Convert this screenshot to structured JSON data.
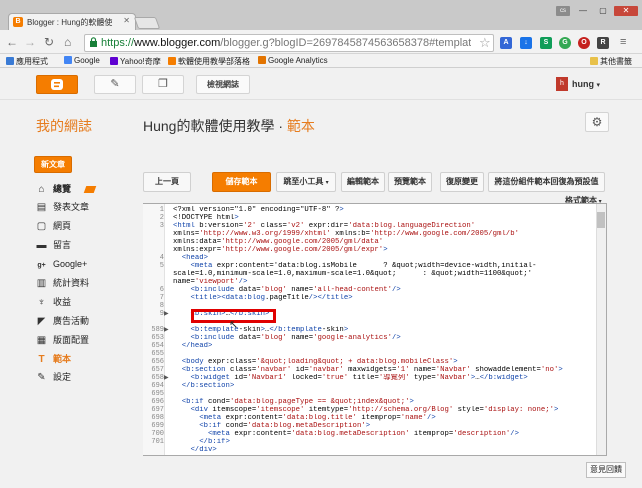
{
  "browser": {
    "tab_title": "Blogger : Hung的軟體使",
    "url_scheme": "https://",
    "url_host": "www.blogger.com",
    "url_path": "/blogger.g?blogID=2697845874563658378#templateh",
    "user_chip": "cs",
    "window_controls": [
      "—",
      "▢",
      "✕"
    ]
  },
  "bookmarks": [
    {
      "label": "應用程式",
      "color": "#3a7bd5"
    },
    {
      "label": "Google",
      "color": "#4285f4"
    },
    {
      "label": "Yahoo!奇摩",
      "color": "#5f01d1"
    },
    {
      "label": "軟體使用教學部落格",
      "color": "#f57d00"
    },
    {
      "label": "Google Analytics",
      "color": "#e37400"
    }
  ],
  "bookmarks_other": "其他書籤",
  "blogger_bar": {
    "view_blog": "檢視網誌",
    "user": "hung"
  },
  "header": {
    "site_name": "我的網誌",
    "blog_title": "Hung的軟體使用教學",
    "separator": " · ",
    "section": "範本"
  },
  "sidebar": {
    "new_post": "新文章",
    "items": [
      {
        "icon": "⌂",
        "label": "總覽"
      },
      {
        "icon": "▤",
        "label": "發表文章"
      },
      {
        "icon": "▢",
        "label": "網頁"
      },
      {
        "icon": "▬",
        "label": "留言"
      },
      {
        "icon": "g+",
        "label": "Google+"
      },
      {
        "icon": "▥",
        "label": "統計資料"
      },
      {
        "icon": "♆",
        "label": "收益"
      },
      {
        "icon": "◤",
        "label": "廣告活動"
      },
      {
        "icon": "▦",
        "label": "版面配置"
      },
      {
        "icon": "T",
        "label": "範本"
      },
      {
        "icon": "✎",
        "label": "設定"
      }
    ]
  },
  "toolbar": {
    "back": "上一頁",
    "save": "儲存範本",
    "jump": "跳至小工具",
    "edit": "編輯範本",
    "preview": "預覽範本",
    "revert": "復原變更",
    "revert_widgets": "將這份組件範本回復為預設值",
    "format": "格式範本"
  },
  "editor": {
    "line_numbers": [
      "1",
      "2",
      "3",
      "",
      "",
      "",
      "",
      "5",
      "",
      "6",
      "7",
      "8",
      "9",
      "589",
      "653",
      "654",
      "655",
      "656",
      "657",
      "658",
      "694",
      "695",
      "696",
      "697",
      "698",
      "699",
      "700",
      "701"
    ],
    "lines": [
      "<?xml version=\"1.0\" encoding=\"UTF-8\" ?>",
      "<!DOCTYPE html>",
      "<html b:version='2' class='v2' expr:dir='data:blog.languageDirection'",
      "xmlns='http://www.w3.org/1999/xhtml' xmlns:b='http://www.google.com/2005/gml/b'",
      "xmlns:data='http://www.google.com/2005/gml/data'",
      "xmlns:expr='http://www.google.com/2005/gml/expr'>",
      "  <head>",
      "    <meta expr:content='data:blog.isMobile      ? &quot;width=device-width,initial-",
      "scale=1.0,minimum-scale=1.0,maximum-scale=1.0&quot;      : &quot;width=1100&quot;'",
      "name='viewport'/>",
      "    <b:include data='blog' name='all-head-content'/>",
      "    <title><data:blog.pageTitle/></title>",
      "",
      "    <b:skin>…</b:skin>",
      "",
      "    <b:template-skin>…</b:template-skin>",
      "    <b:include data='blog' name='google-analytics'/>",
      "  </head>",
      "",
      "  <body expr:class='&quot;loading&quot; + data:blog.mobileClass'>",
      "  <b:section class='navbar' id='navbar' maxwidgets='1' name='Navbar' showaddelement='no'>",
      "    <b:widget id='Navbar1' locked='true' title='導覽列' type='Navbar'>…</b:widget>",
      "  </b:section>",
      "",
      "  <b:if cond='data:blog.pageType == &quot;index&quot;'>",
      "    <div itemscope='itemscope' itemtype='http://schema.org/Blog' style='display: none;'>",
      "      <meta expr:content='data:blog.title' itemprop='name'/>",
      "      <b:if cond='data:blog.metaDescription'>",
      "        <meta expr:content='data:blog.metaDescription' itemprop='description'/>",
      "      </b:if>",
      "    </div>"
    ],
    "visible_line_numbers": [
      "1",
      "2",
      "3",
      "",
      "",
      "",
      "4",
      "5",
      "",
      "",
      "6",
      "7",
      "8",
      "9",
      "",
      "589",
      "653",
      "654",
      "655",
      "656",
      "657",
      "658",
      "694",
      "695",
      "696",
      "697",
      "698",
      "699",
      "700",
      "701"
    ]
  },
  "feedback": "意見回饋"
}
